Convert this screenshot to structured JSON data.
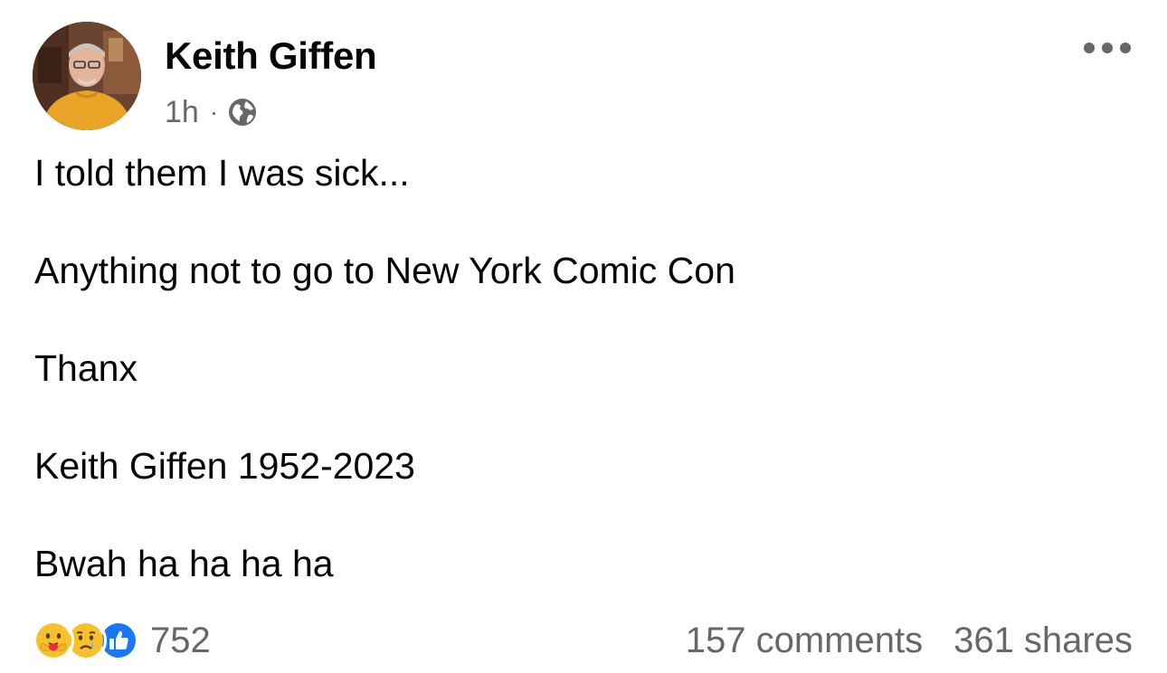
{
  "author": {
    "name": "Keith Giffen",
    "timestamp": "1h",
    "separator": "·",
    "audience_icon": "globe-icon"
  },
  "menu": {
    "icon": "more-horizontal-icon"
  },
  "post": {
    "paragraphs": [
      "I told them I was sick...",
      "Anything not to go to New York Comic Con",
      "Thanx",
      "Keith Giffen 1952-2023",
      "Bwah ha ha ha ha"
    ]
  },
  "footer": {
    "reaction_icons": [
      "care-emoji-icon",
      "sad-emoji-icon",
      "like-emoji-icon"
    ],
    "reaction_count": "752",
    "comments": "157 comments",
    "shares": "361 shares"
  },
  "colors": {
    "text_primary": "#050505",
    "text_secondary": "#65676b",
    "like_blue": "#1877f2",
    "emoji_yellow": "#f7c02c",
    "avatar_sweater": "#e8a427"
  }
}
